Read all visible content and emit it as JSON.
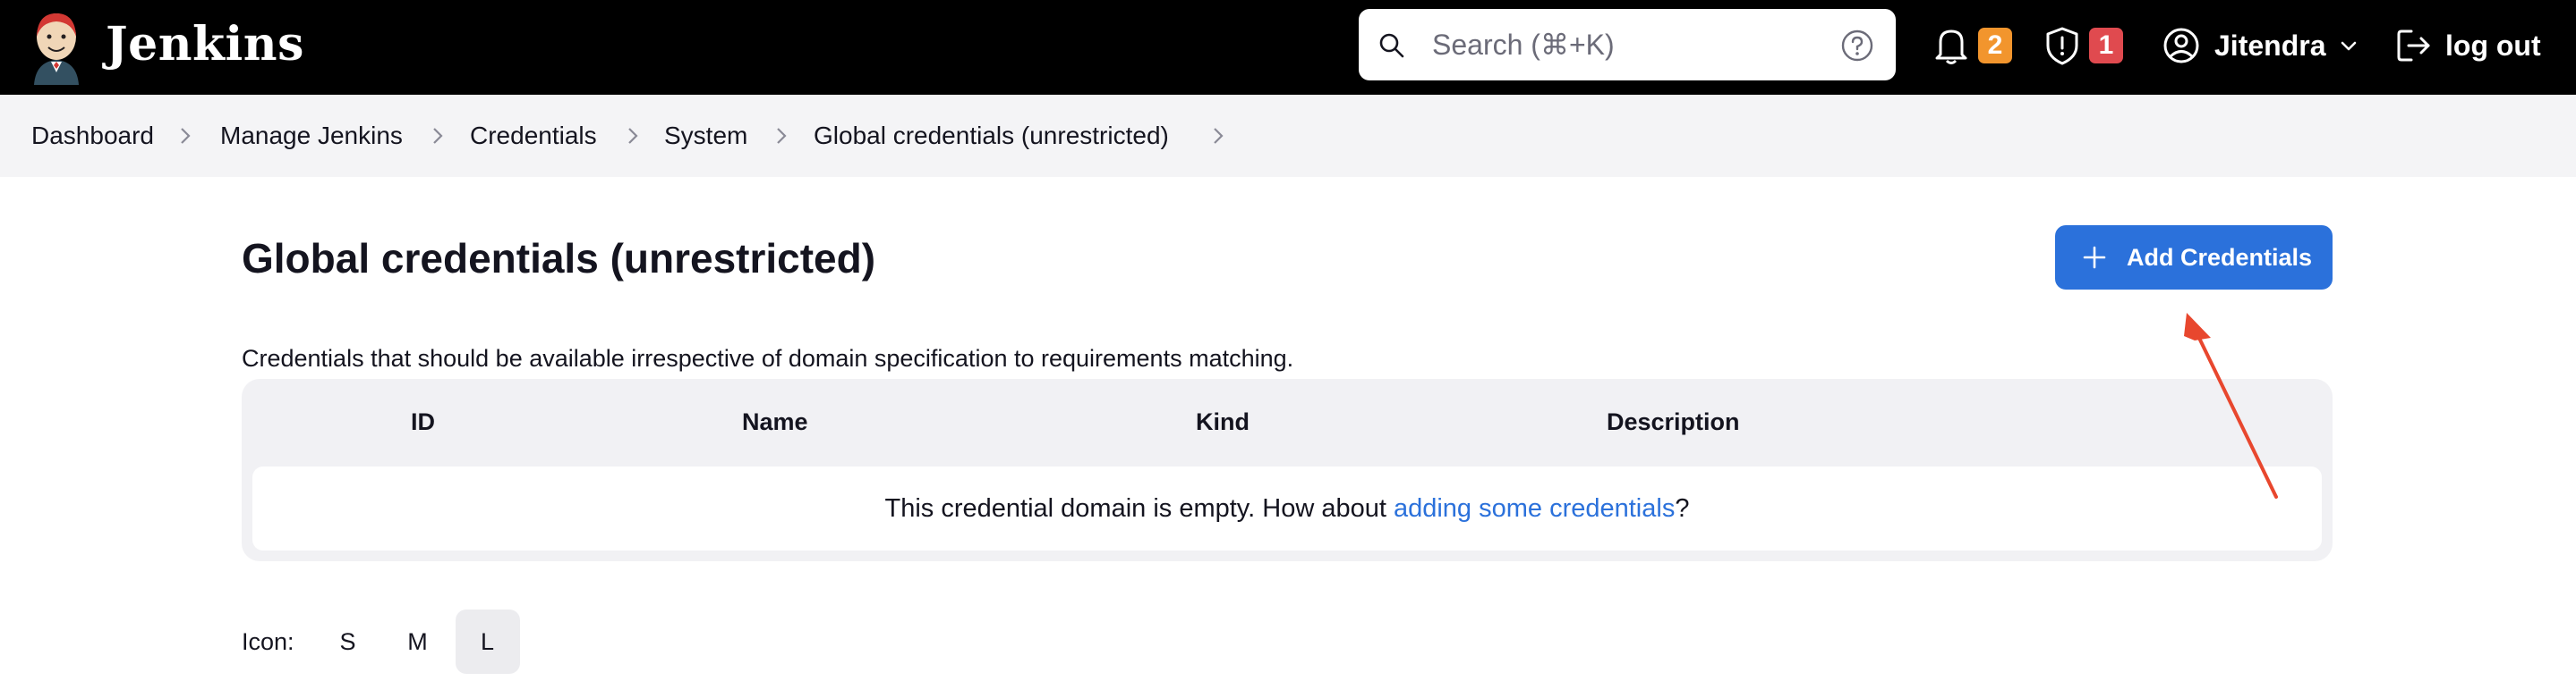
{
  "header": {
    "brand": "Jenkins",
    "search": {
      "placeholder": "Search (⌘+K)",
      "value": ""
    },
    "notifications_count": "2",
    "security_count": "1",
    "user": "Jitendra",
    "logout": "log out"
  },
  "breadcrumbs": [
    "Dashboard",
    "Manage Jenkins",
    "Credentials",
    "System",
    "Global credentials (unrestricted)"
  ],
  "main": {
    "title": "Global credentials (unrestricted)",
    "add_button": "Add Credentials",
    "description": "Credentials that should be available irrespective of domain specification to requirements matching.",
    "table": {
      "columns": [
        "ID",
        "Name",
        "Kind",
        "Description"
      ],
      "empty_text": "This credential domain is empty. How about ",
      "empty_link": "adding some credentials",
      "empty_suffix": "?"
    },
    "icon_size": {
      "label": "Icon:",
      "options": [
        "S",
        "M",
        "L"
      ],
      "selected": "L"
    }
  },
  "colors": {
    "header_bg": "#000000",
    "accent": "#2b71db",
    "notification_badge": "#f2952d",
    "security_badge": "#e04a4f",
    "annotation_arrow": "#e8472e"
  },
  "icons": [
    "jenkins-logo-icon",
    "search-icon",
    "help-icon",
    "bell-icon",
    "shield-icon",
    "user-circle-icon",
    "chevron-down-icon",
    "logout-icon",
    "chevron-right-icon",
    "plus-icon"
  ]
}
